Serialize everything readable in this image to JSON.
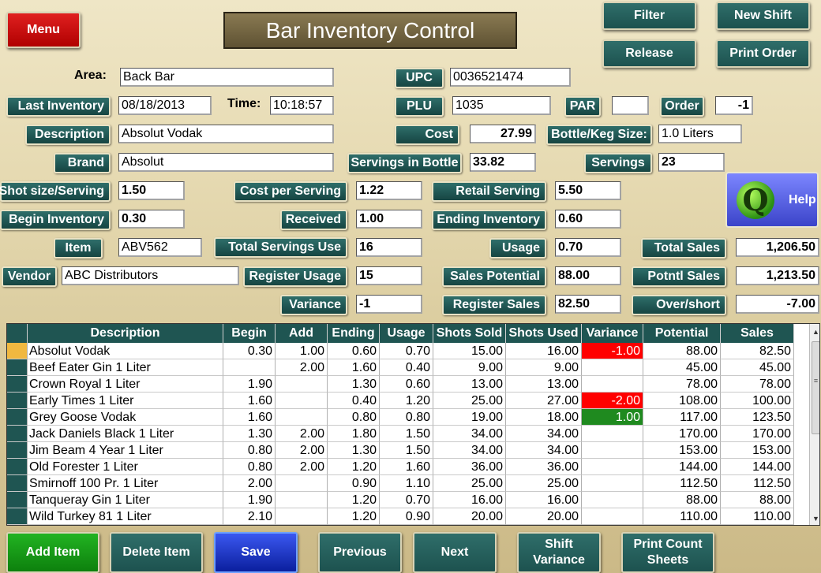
{
  "header": {
    "menu_label": "Menu",
    "title": "Bar Inventory Control",
    "filter_label": "Filter",
    "new_shift_label": "New Shift",
    "release_label": "Release",
    "print_order_label": "Print Order"
  },
  "form": {
    "area_label": "Area:",
    "area_value": "Back Bar",
    "last_inventory_label": "Last Inventory",
    "last_inventory_value": "08/18/2013",
    "time_label": "Time:",
    "time_value": "10:18:57",
    "description_label": "Description",
    "description_value": "Absolut Vodak",
    "brand_label": "Brand",
    "brand_value": "Absolut",
    "shot_size_label": "Shot size/Serving",
    "shot_size_value": "1.50",
    "begin_inventory_label": "Begin Inventory",
    "begin_inventory_value": "0.30",
    "item_label": "Item",
    "item_value": "ABV562",
    "vendor_label": "Vendor",
    "vendor_value": "ABC Distributors",
    "upc_label": "UPC",
    "upc_value": "0036521474",
    "plu_label": "PLU",
    "plu_value": "1035",
    "par_label": "PAR",
    "par_value": "",
    "order_label": "Order",
    "order_value": "-1",
    "cost_label": "Cost",
    "cost_value": "27.99",
    "bottle_size_label": "Bottle/Keg Size:",
    "bottle_size_value": "1.0 Liters",
    "servings_in_bottle_label": "Servings in Bottle",
    "servings_in_bottle_value": "33.82",
    "servings_label": "Servings",
    "servings_value": "23",
    "cost_per_serving_label": "Cost per Serving",
    "cost_per_serving_value": "1.22",
    "retail_serving_label": "Retail  Serving",
    "retail_serving_value": "5.50",
    "received_label": "Received",
    "received_value": "1.00",
    "ending_inventory_label": "Ending Inventory",
    "ending_inventory_value": "0.60",
    "total_servings_use_label": "Total Servings Use",
    "total_servings_use_value": "16",
    "usage_label": "Usage",
    "usage_value": "0.70",
    "total_sales_label": "Total Sales",
    "total_sales_value": "1,206.50",
    "register_usage_label": "Register Usage",
    "register_usage_value": "15",
    "sales_potential_label": "Sales Potential",
    "sales_potential_value": "88.00",
    "potntl_sales_label": "Potntl  Sales",
    "potntl_sales_value": "1,213.50",
    "variance_label": "Variance",
    "variance_value": "-1",
    "register_sales_label": "Register Sales",
    "register_sales_value": "82.50",
    "over_short_label": "Over/short",
    "over_short_value": "-7.00",
    "help_label": "Help",
    "help_icon": "Q"
  },
  "table": {
    "columns": [
      "Description",
      "Begin",
      "Add",
      "Ending",
      "Usage",
      "Shots Sold",
      "Shots Used",
      "Variance",
      "Potential",
      "Sales"
    ],
    "rows": [
      [
        "Absolut Vodak",
        "0.30",
        "1.00",
        "0.60",
        "0.70",
        "15.00",
        "16.00",
        "-1.00",
        "88.00",
        "82.50"
      ],
      [
        "Beef Eater Gin  1 Liter",
        "",
        "2.00",
        "1.60",
        "0.40",
        "9.00",
        "9.00",
        "",
        "45.00",
        "45.00"
      ],
      [
        "Crown Royal   1 Liter",
        "1.90",
        "",
        "1.30",
        "0.60",
        "13.00",
        "13.00",
        "",
        "78.00",
        "78.00"
      ],
      [
        "Early Times 1 Liter",
        "1.60",
        "",
        "0.40",
        "1.20",
        "25.00",
        "27.00",
        "-2.00",
        "108.00",
        "100.00"
      ],
      [
        "Grey Goose Vodak",
        "1.60",
        "",
        "0.80",
        "0.80",
        "19.00",
        "18.00",
        "1.00",
        "117.00",
        "123.50"
      ],
      [
        "Jack Daniels Black 1 Liter",
        "1.30",
        "2.00",
        "1.80",
        "1.50",
        "34.00",
        "34.00",
        "",
        "170.00",
        "170.00"
      ],
      [
        "Jim Beam  4 Year  1 Liter",
        "0.80",
        "2.00",
        "1.30",
        "1.50",
        "34.00",
        "34.00",
        "",
        "153.00",
        "153.00"
      ],
      [
        "Old Forester  1 Liter",
        "0.80",
        "2.00",
        "1.20",
        "1.60",
        "36.00",
        "36.00",
        "",
        "144.00",
        "144.00"
      ],
      [
        "Smirnoff 100 Pr.    1 Liter",
        "2.00",
        "",
        "0.90",
        "1.10",
        "25.00",
        "25.00",
        "",
        "112.50",
        "112.50"
      ],
      [
        "Tanqueray Gin   1 Liter",
        "1.90",
        "",
        "1.20",
        "0.70",
        "16.00",
        "16.00",
        "",
        "88.00",
        "88.00"
      ],
      [
        "Wild Turkey 81   1 Liter",
        "2.10",
        "",
        "1.20",
        "0.90",
        "20.00",
        "20.00",
        "",
        "110.00",
        "110.00"
      ]
    ],
    "selected_row": 0,
    "colors": {
      "negative": "#ff0000",
      "positive": "#1f8a1f",
      "selected": "#f0b840"
    }
  },
  "footer": {
    "add_item_label": "Add Item",
    "delete_item_label": "Delete Item",
    "save_label": "Save",
    "previous_label": "Previous",
    "next_label": "Next",
    "shift_variance_label_1": "Shift",
    "shift_variance_label_2": "Variance",
    "print_count_label_1": "Print Count",
    "print_count_label_2": "Sheets"
  }
}
